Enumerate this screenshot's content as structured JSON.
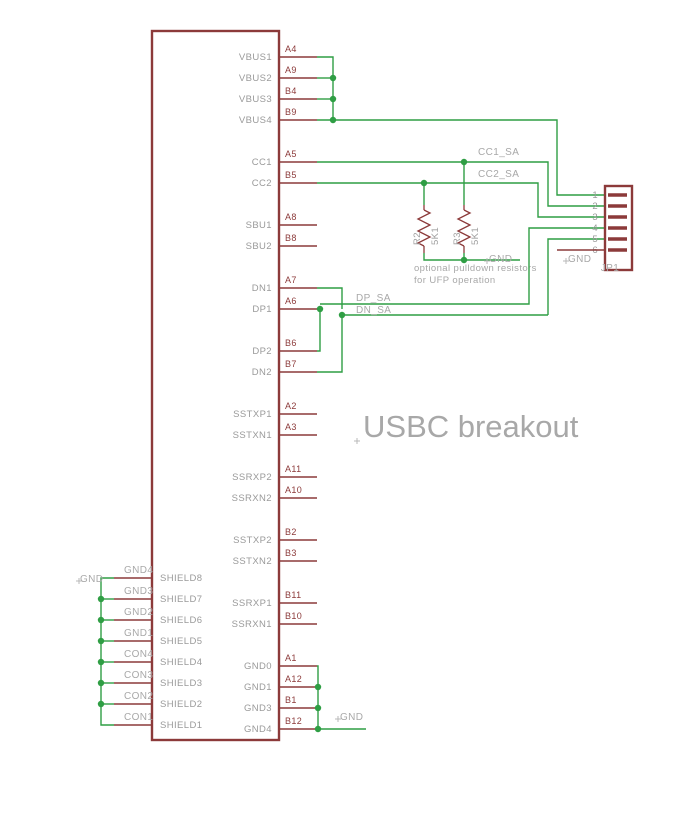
{
  "sheet": {
    "title": "USBC breakout",
    "background": "#ffffff",
    "wire_color": "#2f9e44",
    "symbol_color": "#8c3a3a",
    "label_color": "#9a9a9a"
  },
  "connector_usbc": {
    "ref": "",
    "left_pins": [
      {
        "name": "SHIELD8",
        "net": "GND4"
      },
      {
        "name": "SHIELD7",
        "net": "GND3"
      },
      {
        "name": "SHIELD6",
        "net": "GND2"
      },
      {
        "name": "SHIELD5",
        "net": "GND1"
      },
      {
        "name": "SHIELD4",
        "net": "CON4"
      },
      {
        "name": "SHIELD3",
        "net": "CON3"
      },
      {
        "name": "SHIELD2",
        "net": "CON2"
      },
      {
        "name": "SHIELD1",
        "net": "CON1"
      }
    ],
    "right_pins": [
      {
        "name": "VBUS1",
        "number": "A4"
      },
      {
        "name": "VBUS2",
        "number": "A9"
      },
      {
        "name": "VBUS3",
        "number": "B4"
      },
      {
        "name": "VBUS4",
        "number": "B9"
      },
      {
        "name": "CC1",
        "number": "A5"
      },
      {
        "name": "CC2",
        "number": "B5"
      },
      {
        "name": "SBU1",
        "number": "A8"
      },
      {
        "name": "SBU2",
        "number": "B8"
      },
      {
        "name": "DN1",
        "number": "A7"
      },
      {
        "name": "DP1",
        "number": "A6"
      },
      {
        "name": "DP2",
        "number": "B6"
      },
      {
        "name": "DN2",
        "number": "B7"
      },
      {
        "name": "SSTXP1",
        "number": "A2"
      },
      {
        "name": "SSTXN1",
        "number": "A3"
      },
      {
        "name": "SSRXP2",
        "number": "A11"
      },
      {
        "name": "SSRXN2",
        "number": "A10"
      },
      {
        "name": "SSTXP2",
        "number": "B2"
      },
      {
        "name": "SSTXN2",
        "number": "B3"
      },
      {
        "name": "SSRXP1",
        "number": "B11"
      },
      {
        "name": "SSRXN1",
        "number": "B10"
      },
      {
        "name": "GND0",
        "number": "A1"
      },
      {
        "name": "GND1",
        "number": "A12"
      },
      {
        "name": "GND3",
        "number": "B1"
      },
      {
        "name": "GND4",
        "number": "B12"
      }
    ]
  },
  "resistors": [
    {
      "ref": "R2",
      "value": "5K1"
    },
    {
      "ref": "R3",
      "value": "5K1"
    }
  ],
  "header_jp1": {
    "ref": "JP1",
    "pins": [
      {
        "number": "1"
      },
      {
        "number": "2"
      },
      {
        "number": "3"
      },
      {
        "number": "4"
      },
      {
        "number": "5"
      },
      {
        "number": "6"
      }
    ]
  },
  "net_labels": [
    {
      "text": "CC1_SA"
    },
    {
      "text": "CC2_SA"
    },
    {
      "text": "DP_SA"
    },
    {
      "text": "DN_SA"
    }
  ],
  "gnd_labels": [
    {
      "text": "GND"
    },
    {
      "text": "GND"
    },
    {
      "text": "GND"
    },
    {
      "text": "GND"
    }
  ],
  "notes": [
    {
      "text": "optional pulldown resistors"
    },
    {
      "text": "for UFP operation"
    }
  ]
}
